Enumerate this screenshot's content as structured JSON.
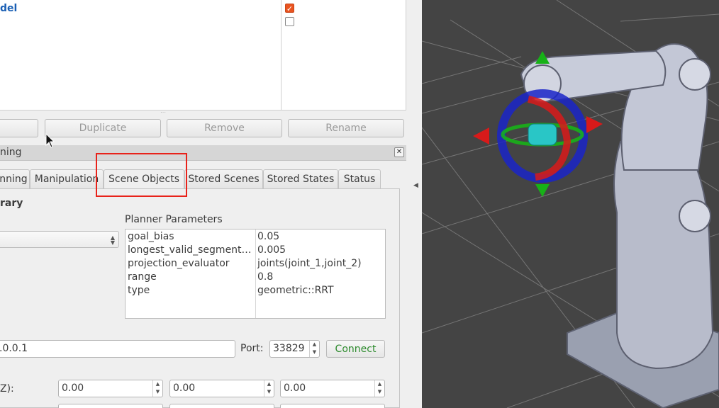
{
  "displays": {
    "tree_items": [
      "",
      "del"
    ],
    "checkboxes": [
      true,
      false
    ]
  },
  "buttons": {
    "first": "",
    "duplicate": "Duplicate",
    "remove": "Remove",
    "rename": "Rename"
  },
  "panel": {
    "title": "ning",
    "close": "✕"
  },
  "tabs": [
    {
      "label": "nning"
    },
    {
      "label": "Manipulation"
    },
    {
      "label": "Scene Objects"
    },
    {
      "label": "Stored Scenes"
    },
    {
      "label": "Stored States"
    },
    {
      "label": "Status"
    }
  ],
  "planning": {
    "library_label": "rary",
    "planner_params_label": "Planner Parameters",
    "combo_value": "",
    "params": [
      {
        "key": "goal_bias",
        "value": "0.05"
      },
      {
        "key": "longest_valid_segment…",
        "value": "0.005"
      },
      {
        "key": "projection_evaluator",
        "value": "joints(joint_1,joint_2)"
      },
      {
        "key": "range",
        "value": "0.8"
      },
      {
        "key": "type",
        "value": "geometric::RRT"
      }
    ]
  },
  "database": {
    "host_value": ".0.0.1",
    "port_label": "Port:",
    "port_value": "33829",
    "connect_label": "Connect"
  },
  "workspace": {
    "label": "Z):",
    "values": [
      "0.00",
      "0.00",
      "0.00"
    ]
  },
  "colors": {
    "accent_orange": "#e95420",
    "link_blue": "#1a5fb4",
    "connect_green": "#2e8b2e",
    "highlight_red": "#e8221a",
    "viewport_bg": "#444444"
  }
}
